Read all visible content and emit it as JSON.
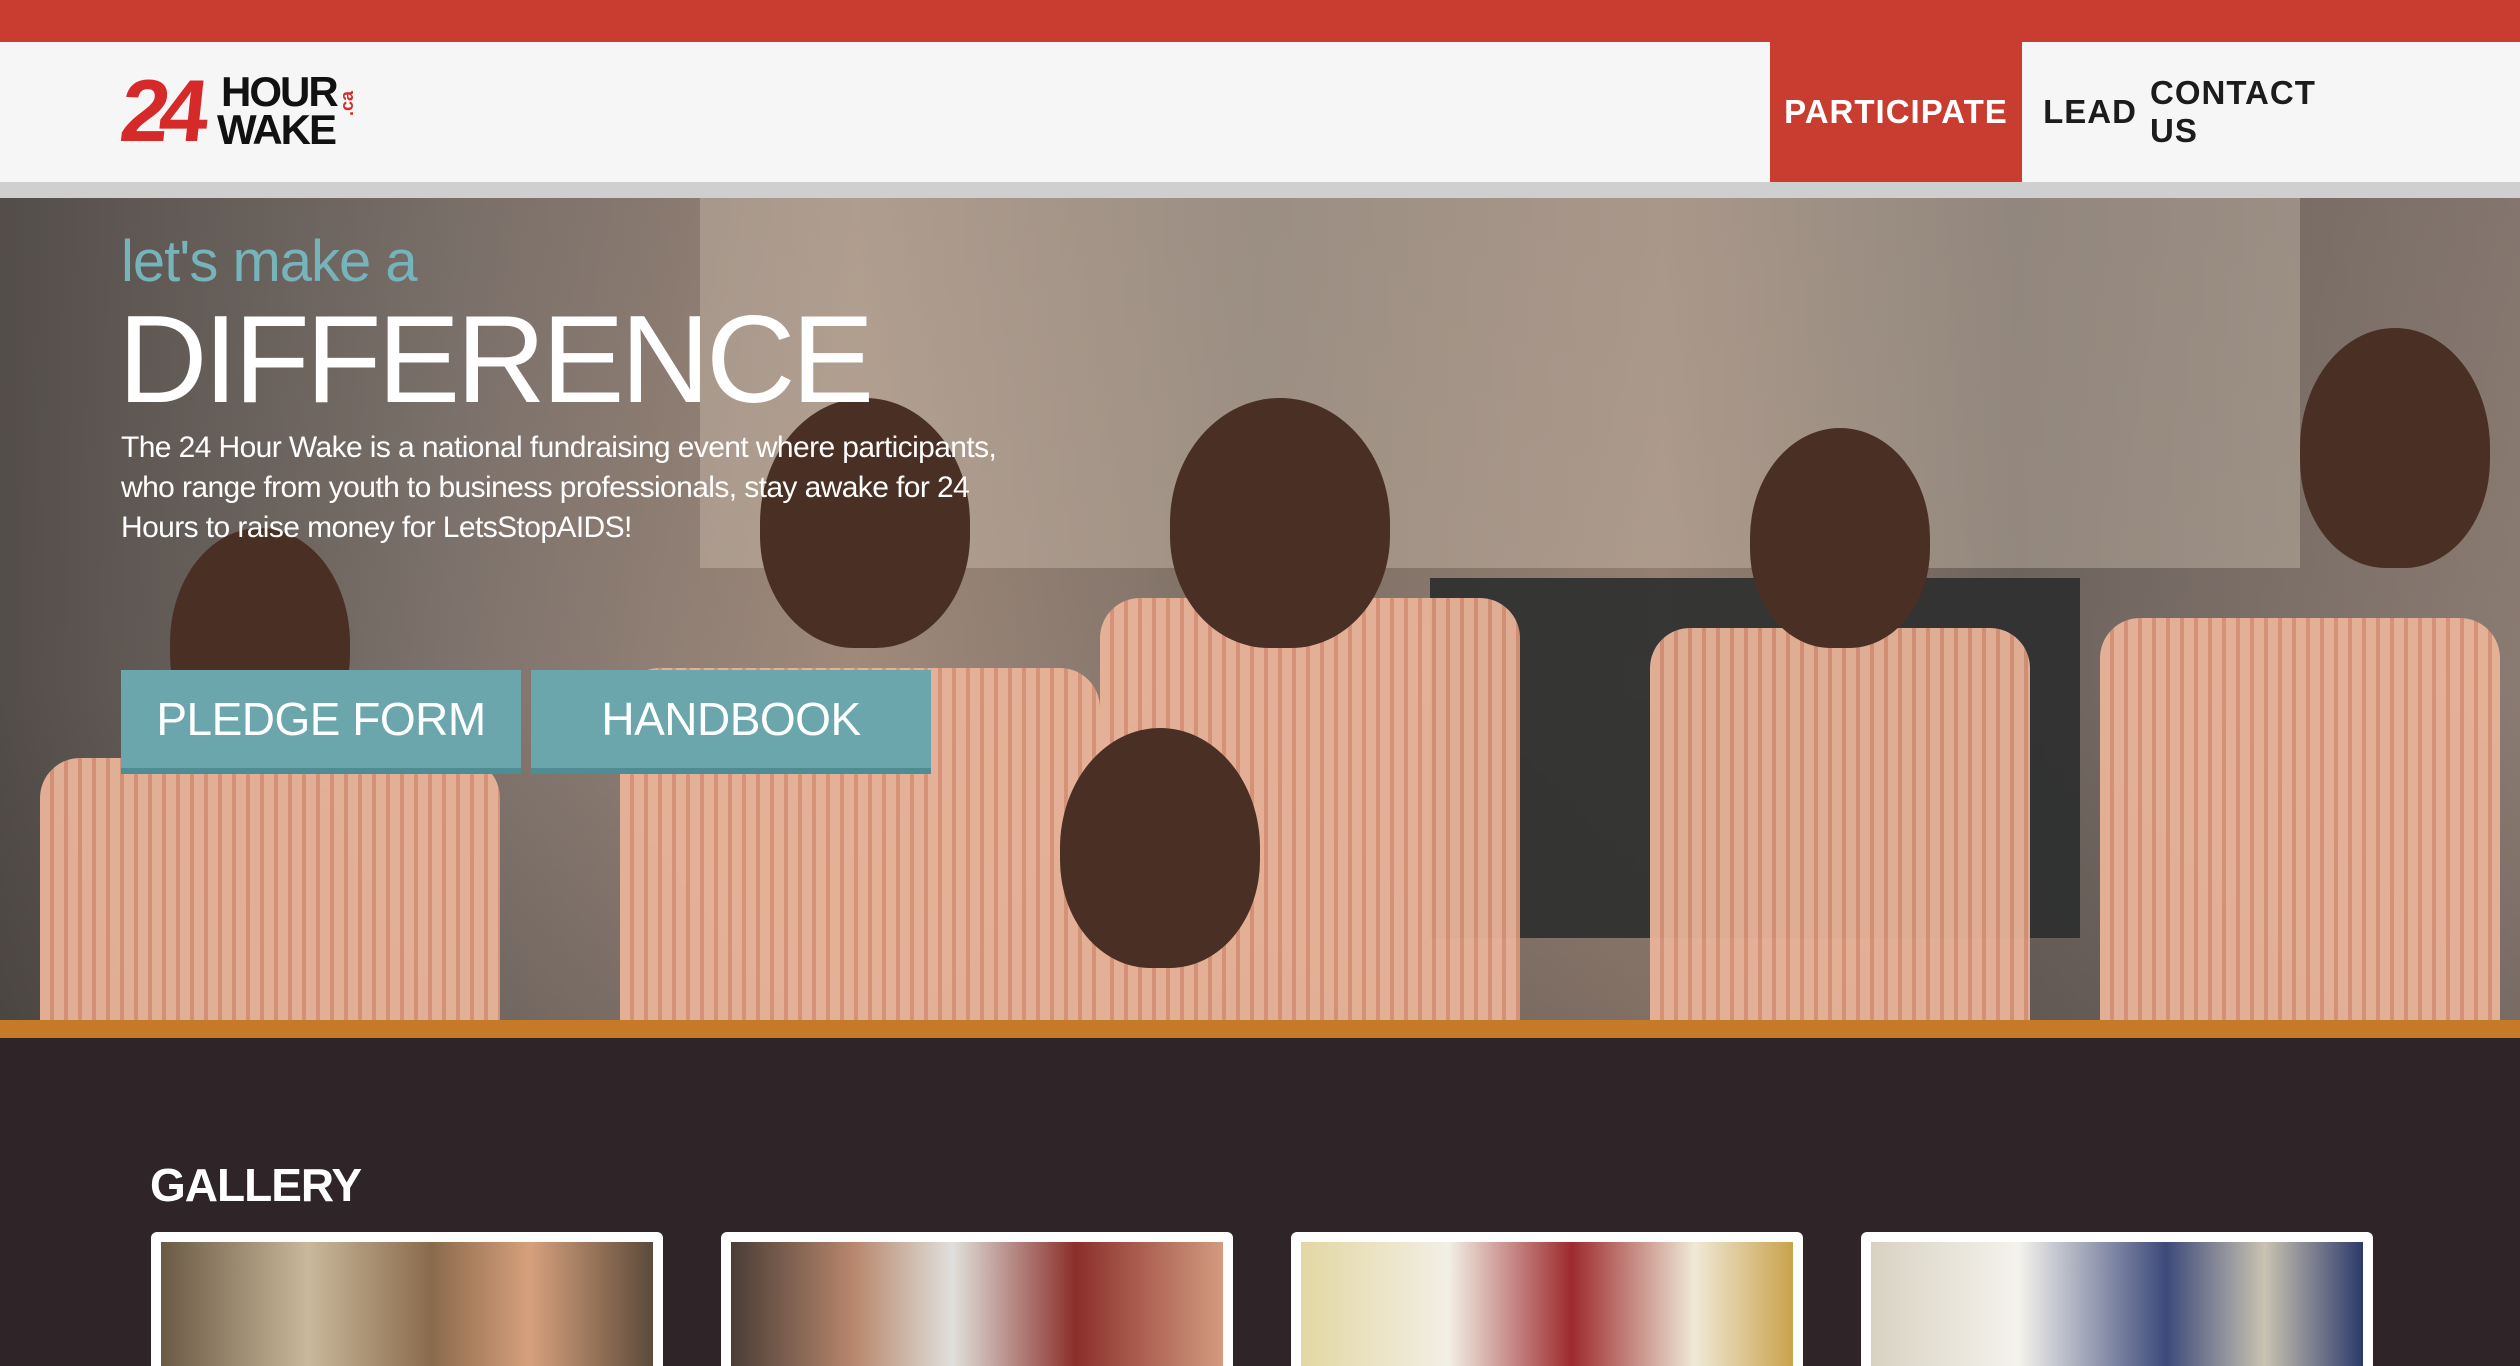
{
  "header": {
    "logo": {
      "number": "24",
      "line1": "HOUR",
      "line2": "WAKE",
      "suffix": ".ca"
    },
    "nav": [
      {
        "label": "PARTICIPATE",
        "active": true
      },
      {
        "label": "LEAD",
        "active": false
      },
      {
        "label": "CONTACT US",
        "active": false
      }
    ]
  },
  "hero": {
    "tagline_small": "let's make a",
    "tagline_big": "DIFFERENCE",
    "description": "The 24 Hour Wake is a national fundraising event where participants, who range from youth to business professionals, stay awake for 24 Hours to raise money for LetsStopAIDS!",
    "buttons": {
      "pledge": "PLEDGE FORM",
      "handbook": "HANDBOOK"
    }
  },
  "gallery": {
    "title": "GALLERY"
  },
  "colors": {
    "brand_red": "#c93c30",
    "accent_teal": "#6aa6ac",
    "tagline_teal": "#76b3bb",
    "orange_divider": "#c47a26",
    "dark_background": "#2f2528"
  }
}
